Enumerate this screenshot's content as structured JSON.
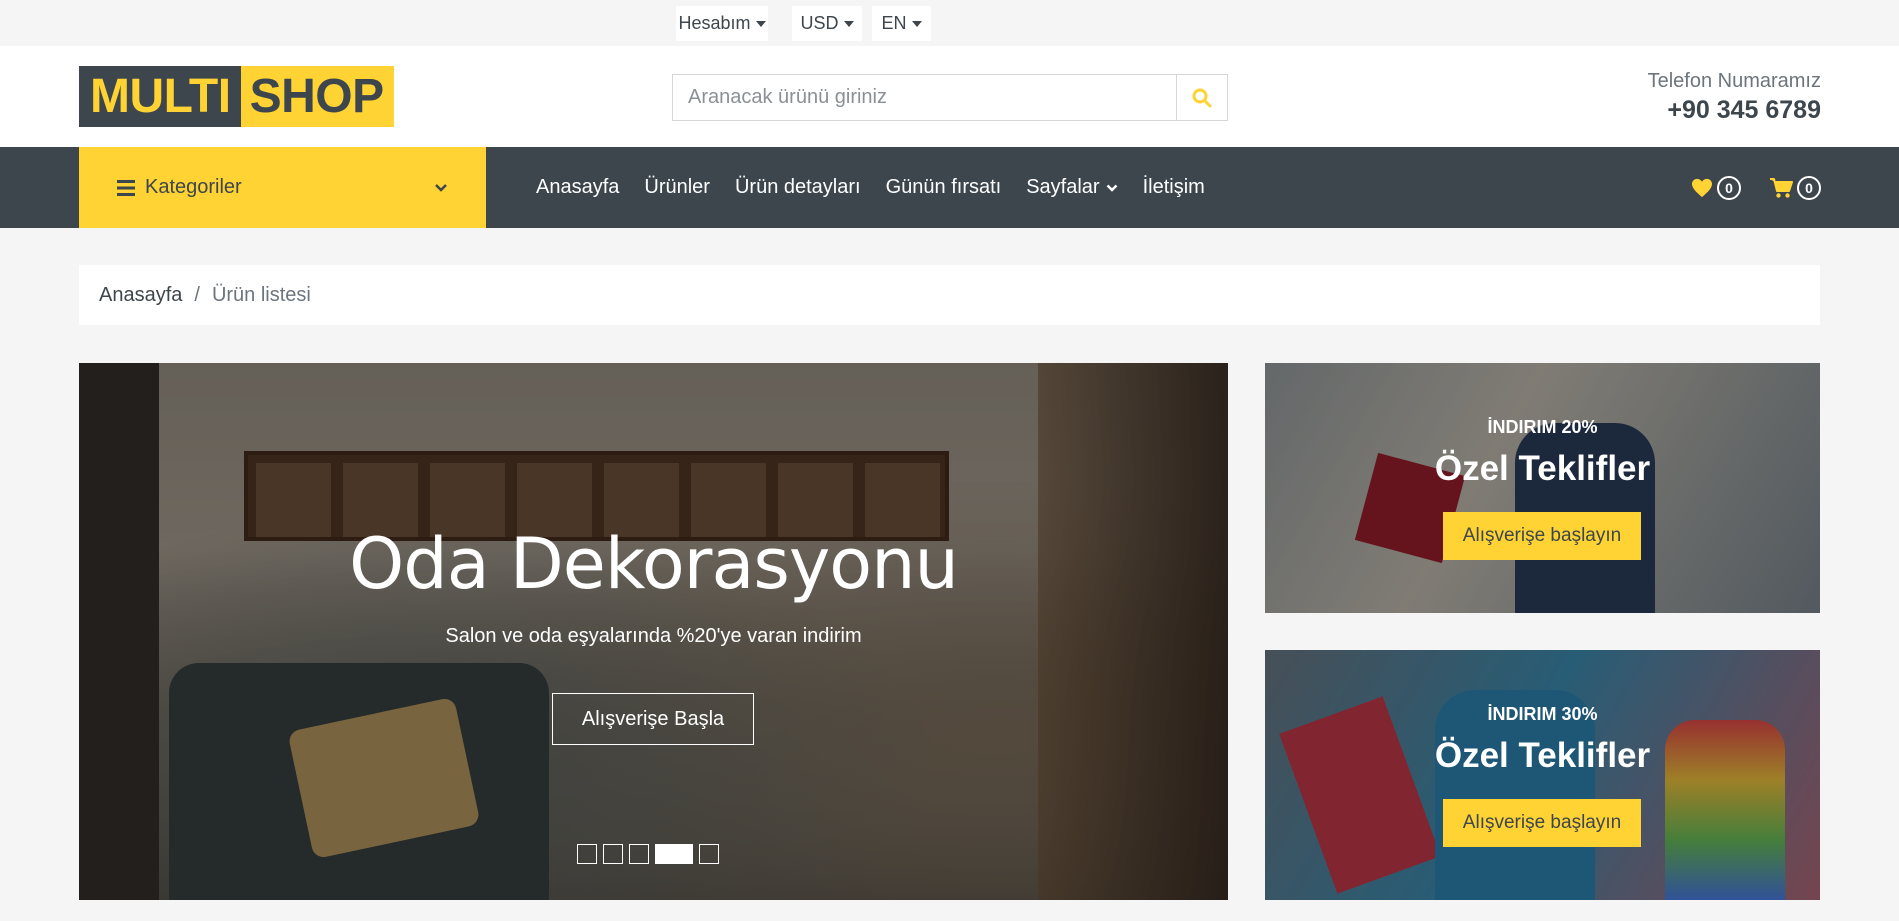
{
  "topbar": {
    "account_label": "Hesabım",
    "currency_label": "USD",
    "language_label": "EN"
  },
  "header": {
    "logo_part1": "MULTI",
    "logo_part2": "SHOP",
    "search_placeholder": "Aranacak ürünü giriniz",
    "phone_label": "Telefon Numaramız",
    "phone_number": "+90 345 6789"
  },
  "nav": {
    "categories_label": "Kategoriler",
    "links": [
      "Anasayfa",
      "Ürünler",
      "Ürün detayları",
      "Günün fırsatı",
      "Sayfalar",
      "İletişim"
    ],
    "wishlist_count": "0",
    "cart_count": "0"
  },
  "breadcrumb": {
    "home": "Anasayfa",
    "separator": "/",
    "current": "Ürün listesi"
  },
  "hero": {
    "title": "Oda Dekorasyonu",
    "subtitle": "Salon ve oda eşyalarında %20'ye varan indirim",
    "button": "Alışverişe Başla",
    "active_slide": 4,
    "slide_count": 5
  },
  "offers": [
    {
      "discount": "İNDIRIM 20%",
      "title": "Özel Teklifler",
      "button": "Alışverişe başlayın"
    },
    {
      "discount": "İNDIRIM 30%",
      "title": "Özel Teklifler",
      "button": "Alışverişe başlayın"
    }
  ],
  "colors": {
    "accent": "#ffd333",
    "dark": "#3d464d",
    "background": "#f5f5f5"
  }
}
